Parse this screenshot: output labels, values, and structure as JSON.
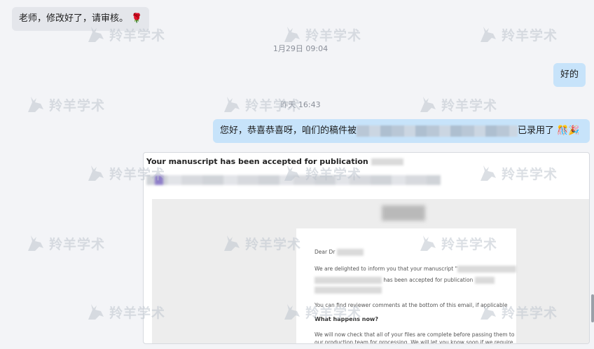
{
  "messages": [
    {
      "side": "in",
      "text": "老师，修改好了，请审核。",
      "emoji": "🌹"
    },
    {
      "side": "out",
      "text": "好的"
    },
    {
      "side": "out",
      "text_before": "您好，恭喜恭喜呀，咱们的稿件被",
      "text_after": "已录用了",
      "emoji": "🎊🎉"
    }
  ],
  "timestamps": [
    "1月29日 09:04",
    "昨天 16:43"
  ],
  "watermark": "羚羊学术",
  "email": {
    "subject": "Your manuscript has been accepted for publication",
    "greeting": "Dear Dr",
    "line1": "We are delighted to inform you that your manuscript \"",
    "line2": "has been accepted for publication",
    "line3": "You can find reviewer comments at the bottom of this email, if applicable",
    "heading": "What happens now?",
    "line4": "We will now check that all of your files are complete before passing them to",
    "line5": "our production team for processing. We will let you know soon if we require"
  },
  "colors": {
    "background": "#f3f4f7",
    "incoming_bubble": "#e4e6eb",
    "outgoing_bubble": "#c7e3fa",
    "watermark": "#bec4ce"
  }
}
